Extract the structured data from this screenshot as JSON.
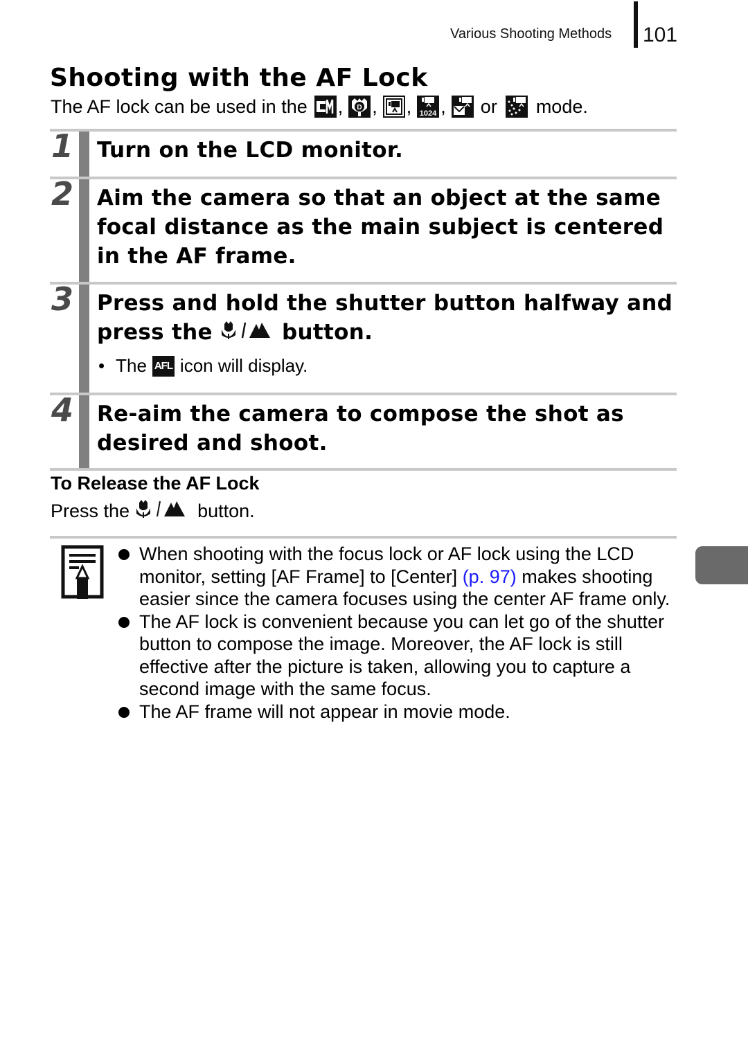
{
  "header": {
    "running_head": "Various Shooting Methods",
    "page_number": "101"
  },
  "section": {
    "title": "Shooting with the AF Lock",
    "intro_prefix": "The AF lock can be used in the",
    "intro_modes": [
      {
        "icon": "custom-manual-mode-icon",
        "sep": ","
      },
      {
        "icon": "digital-macro-mode-icon",
        "sep": ","
      },
      {
        "icon": "movie-standard-mode-icon",
        "sep": ","
      },
      {
        "icon": "movie-1024-mode-icon",
        "sep": ","
      },
      {
        "icon": "movie-compact-mode-icon",
        "sep": "or"
      },
      {
        "icon": "movie-color-accent-mode-icon",
        "sep": ""
      }
    ],
    "intro_suffix": "mode."
  },
  "steps": [
    {
      "number": "1",
      "text": "Turn on the LCD monitor."
    },
    {
      "number": "2",
      "text": "Aim the camera so that an object at the same focal distance as the main subject is centered in the AF frame."
    },
    {
      "number": "3",
      "text_before": "Press and hold the shutter button halfway and press the",
      "text_after": "button.",
      "bullet_before": "The",
      "bullet_icon": "AFL",
      "bullet_after": "icon will display."
    },
    {
      "number": "4",
      "text": "Re-aim the camera to compose the shot as desired and shoot."
    }
  ],
  "release": {
    "heading": "To Release the AF Lock",
    "text_before": "Press the",
    "text_after": "button."
  },
  "notes": {
    "items": [
      {
        "before": "When shooting with the focus lock or AF lock using the LCD monitor, setting [AF Frame] to [Center]",
        "link": "(p. 97)",
        "after": "makes shooting easier since the camera focuses using the center AF frame only."
      },
      {
        "text": "The AF lock is convenient because you can let go of the shutter button to compose the image. Moreover, the AF lock is still effective after the picture is taken, allowing you to capture a second image with the same focus."
      },
      {
        "text": "The AF frame will not appear in movie mode."
      }
    ]
  },
  "colors": {
    "step_bar": "#808080",
    "rule": "#c8c8c8",
    "link": "#1a1aff",
    "side_tab": "#6a6a6a"
  }
}
